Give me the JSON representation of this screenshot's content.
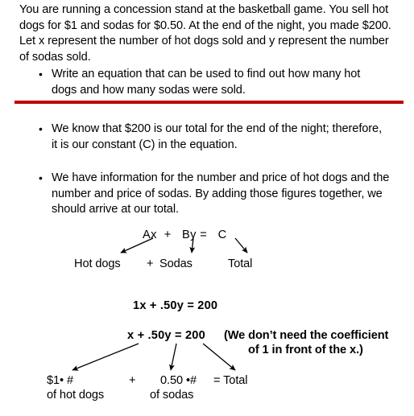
{
  "document": {
    "intro_paragraph": "You are running a concession stand at the basketball game.  You sell hot dogs for $1 and sodas for $0.50.   At the end of the night, you made $200.  Let x represent the number of hot dogs sold and y represent the number of sodas sold.",
    "bullet_marker": "•",
    "bullets": [
      {
        "id": "write-equation",
        "text": "Write an equation that can be used to find out how many hot dogs and how many sodas were sold."
      },
      {
        "id": "constant",
        "text": "We know that $200 is our total for the end of the night; therefore, it is our constant (C) in the equation."
      },
      {
        "id": "information",
        "text": "We have information for the number and price of hot dogs and the number and price of sodas.  By adding those figures together, we should arrive at our total."
      }
    ],
    "divider_color": "#C00000"
  },
  "formula_diagram": {
    "equation": "Ax  +   By =   C",
    "labels": {
      "hot_dogs": "Hot dogs",
      "plus": "+",
      "sodas": "Sodas",
      "total": "Total"
    }
  },
  "equations": {
    "line_1": "1x + .50y = 200",
    "line_2": "x + .50y = 200",
    "note_line_1": "(We don’t need the coefficient",
    "note_line_2": "of 1 in front of the x.)"
  },
  "breakdown": {
    "term1_top": "$1• #",
    "term1_bottom": "of hot dogs",
    "plus": "+",
    "term2_top": "0.50 •#",
    "term2_bottom": "of sodas",
    "equals_total": "= Total"
  }
}
